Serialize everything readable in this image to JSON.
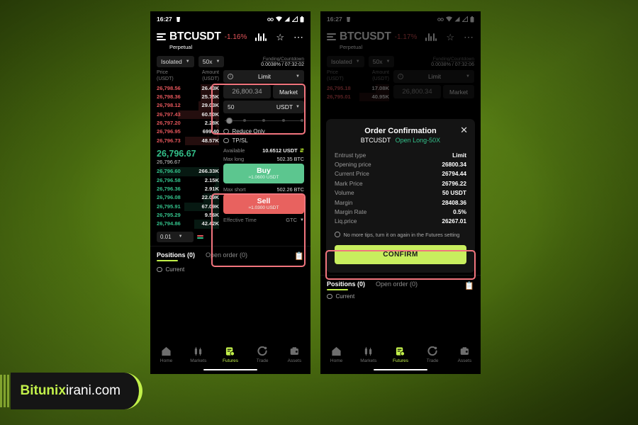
{
  "watermark": {
    "brand": "Bitunix",
    "domain": "irani.com"
  },
  "statusbar": {
    "time": "16:27"
  },
  "left": {
    "header": {
      "pair": "BTCUSDT",
      "change": "-1.16%",
      "subtitle": "Perpetual"
    },
    "controls": {
      "margin_mode": "Isolated",
      "leverage": "50x",
      "funding_label": "Funding/Countdown",
      "funding_value": "0.0038% / 07:32:02"
    },
    "orderbook": {
      "col_price": "Price",
      "col_price_unit": "(USDT)",
      "col_amount": "Amount",
      "col_amount_unit": "(USDT)",
      "asks": [
        {
          "price": "26,798.56",
          "amount": "26.43K",
          "depth": 30
        },
        {
          "price": "26,798.36",
          "amount": "25.75K",
          "depth": 29
        },
        {
          "price": "26,798.12",
          "amount": "29.03K",
          "depth": 33
        },
        {
          "price": "26,797.43",
          "amount": "60.50K",
          "depth": 66
        },
        {
          "price": "26,797.20",
          "amount": "2.28K",
          "depth": 6
        },
        {
          "price": "26,796.95",
          "amount": "699.40",
          "depth": 3
        },
        {
          "price": "26,796.73",
          "amount": "48.57K",
          "depth": 54
        }
      ],
      "last_price": "26,796.67",
      "mark_price": "26,796.67",
      "bids": [
        {
          "price": "26,796.60",
          "amount": "266.33K",
          "depth": 95
        },
        {
          "price": "26,796.58",
          "amount": "2.15K",
          "depth": 6
        },
        {
          "price": "26,796.36",
          "amount": "2.91K",
          "depth": 8
        },
        {
          "price": "26,796.08",
          "amount": "22.09K",
          "depth": 25
        },
        {
          "price": "26,795.91",
          "amount": "67.09K",
          "depth": 56
        },
        {
          "price": "26,795.29",
          "amount": "9.56K",
          "depth": 14
        },
        {
          "price": "26,794.86",
          "amount": "42.42K",
          "depth": 40
        }
      ],
      "tick_size": "0.01"
    },
    "form": {
      "order_type": "Limit",
      "price_value": "26,800.34",
      "market_label": "Market",
      "amount_value": "50",
      "amount_unit": "USDT",
      "reduce_only": "Reduce Only",
      "tp_sl": "TP/SL",
      "available_label": "Available",
      "available_value": "10.6512 USDT",
      "max_long_label": "Max long",
      "max_long_value": "502.35 BTC",
      "buy_label": "Buy",
      "buy_sub": "≈1.0600 USDT",
      "max_short_label": "Max short",
      "max_short_value": "502.26 BTC",
      "sell_label": "Sell",
      "sell_sub": "≈1.0300 USDT",
      "effective_time_label": "Effective Time",
      "effective_time_value": "GTC"
    },
    "positions": {
      "tab_positions": "Positions (0)",
      "tab_open_order": "Open order (0)",
      "current": "Current"
    },
    "nav": [
      {
        "label": "Home",
        "icon": "home-icon"
      },
      {
        "label": "Markets",
        "icon": "markets-icon"
      },
      {
        "label": "Futures",
        "icon": "futures-icon"
      },
      {
        "label": "Trade",
        "icon": "trade-icon"
      },
      {
        "label": "Assets",
        "icon": "assets-icon"
      }
    ]
  },
  "right": {
    "header": {
      "pair": "BTCUSDT",
      "change": "-1.17%",
      "subtitle": "Perpetual"
    },
    "controls": {
      "margin_mode": "Isolated",
      "leverage": "50x",
      "funding_label": "Funding/Countdown",
      "funding_value": "0.0038% / 07:32:06"
    },
    "orderbook": {
      "col_price": "Price",
      "col_price_unit": "(USDT)",
      "col_amount": "Amount",
      "col_amount_unit": "(USDT)",
      "asks": [
        {
          "price": "26,795.18",
          "amount": "17.08K",
          "depth": 22
        },
        {
          "price": "26,795.01",
          "amount": "40.95K",
          "depth": 48
        }
      ]
    },
    "form": {
      "order_type": "Limit",
      "price_value": "26,800.34",
      "market_label": "Market"
    },
    "modal": {
      "title": "Order Confirmation",
      "pair": "BTCUSDT",
      "direction": "Open Long-50X",
      "close_icon": "close-icon",
      "rows": [
        {
          "key": "Entrust type",
          "value": "Limit"
        },
        {
          "key": "Opening price",
          "value": "26800.34"
        },
        {
          "key": "Current Price",
          "value": "26794.44"
        },
        {
          "key": "Mark Price",
          "value": "26796.22"
        },
        {
          "key": "Volume",
          "value": "50 USDT"
        },
        {
          "key": "Margin",
          "value": "28408.36"
        },
        {
          "key": "Margin Rate",
          "value": "0.5%"
        },
        {
          "key": "Liq.price",
          "value": "26267.01"
        }
      ],
      "no_more_tips": "No more tips, turn it on again in the Futures setting",
      "confirm_label": "CONFIRM"
    },
    "positions": {
      "tab_positions": "Positions (0)",
      "tab_open_order": "Open order (0)",
      "current": "Current"
    },
    "nav": [
      {
        "label": "Home",
        "icon": "home-icon"
      },
      {
        "label": "Markets",
        "icon": "markets-icon"
      },
      {
        "label": "Futures",
        "icon": "futures-icon"
      },
      {
        "label": "Trade",
        "icon": "trade-icon"
      },
      {
        "label": "Assets",
        "icon": "assets-icon"
      }
    ]
  }
}
